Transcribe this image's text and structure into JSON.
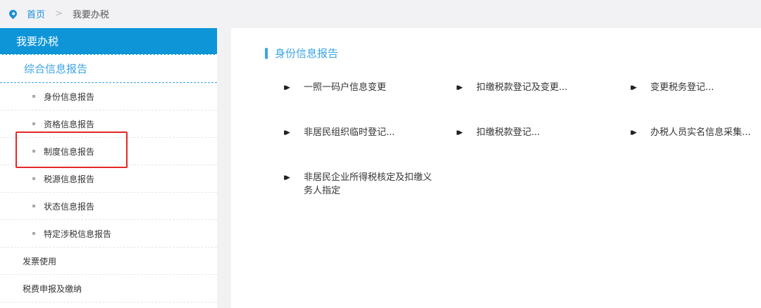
{
  "breadcrumb": {
    "home": "首页",
    "separator": ">",
    "current": "我要办税"
  },
  "sidebar": {
    "header": "我要办税",
    "section": "综合信息报告",
    "items": [
      "身份信息报告",
      "资格信息报告",
      "制度信息报告",
      "税源信息报告",
      "状态信息报告",
      "特定涉税信息报告"
    ],
    "top_items": [
      "发票使用",
      "税费申报及缴纳"
    ]
  },
  "main": {
    "title": "身份信息报告",
    "links": [
      "一照一码户信息变更",
      "扣缴税款登记及变更...",
      "变更税务登记...",
      "非居民组织临时登记...",
      "扣缴税款登记...",
      "办税人员实名信息采集...",
      "非居民企业所得税核定及扣缴义务人指定"
    ]
  },
  "colors": {
    "accent": "#0d95d8",
    "highlight": "#e62727"
  }
}
